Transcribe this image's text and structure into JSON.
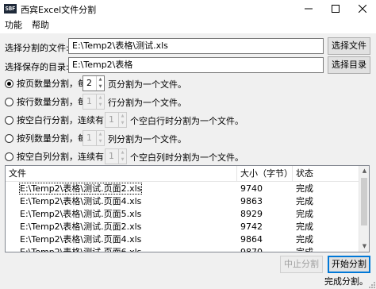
{
  "window": {
    "icon_text": "SBF",
    "title": "西宾Excel文件分割"
  },
  "menu": [
    "功能",
    "帮助"
  ],
  "file_row": {
    "label": "选择分割的文件:",
    "value": "E:\\Temp2\\表格\\测试.xls",
    "button": "选择文件"
  },
  "dir_row": {
    "label": "选择保存的目录:",
    "value": "E:\\Temp2\\表格",
    "button": "选择目录"
  },
  "options": [
    {
      "prefix": "按页数量分割，每",
      "value": "2",
      "suffix": "页分割为一个文件。",
      "checked": true,
      "enabled": true
    },
    {
      "prefix": "按行数量分割，每",
      "value": "1",
      "suffix": "行分割为一个文件。",
      "checked": false,
      "enabled": false
    },
    {
      "prefix": "按空白行分割，连续有",
      "value": "1",
      "suffix": "个空白行时分割为一个文件。",
      "checked": false,
      "enabled": false
    },
    {
      "prefix": "按列数量分割，每",
      "value": "1",
      "suffix": "列分割为一个文件。",
      "checked": false,
      "enabled": false
    },
    {
      "prefix": "按空白列分割，连续有",
      "value": "1",
      "suffix": "个空白列时分割为一个文件。",
      "checked": false,
      "enabled": false
    }
  ],
  "table": {
    "columns": [
      "文件",
      "大小（字节）",
      "状态"
    ],
    "rows": [
      [
        "E:\\Temp2\\表格\\测试.页面2.xls",
        "9740",
        "完成"
      ],
      [
        "E:\\Temp2\\表格\\测试.页面4.xls",
        "9863",
        "完成"
      ],
      [
        "E:\\Temp2\\表格\\测试.页面5.xls",
        "8929",
        "完成"
      ],
      [
        "E:\\Temp2\\表格\\测试.页面2.xls",
        "9742",
        "完成"
      ],
      [
        "E:\\Temp2\\表格\\测试.页面4.xls",
        "9864",
        "完成"
      ],
      [
        "E:\\Temp2\\表格\\测试.页面6.xls",
        "9870",
        "完成"
      ]
    ]
  },
  "buttons": {
    "stop": "中止分割",
    "start": "开始分割"
  },
  "status": "完成分割。",
  "icons": {
    "minimize": "minimize-icon",
    "maximize": "maximize-icon",
    "close": "close-icon"
  }
}
